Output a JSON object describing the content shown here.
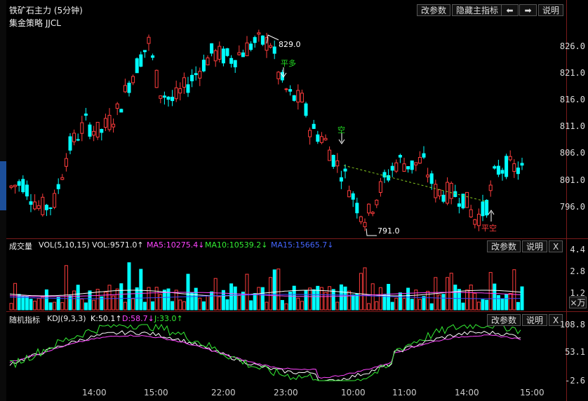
{
  "title": "铁矿石主力 (5分钟)",
  "strategy": "集金策略 JJCL",
  "toolbar": {
    "modify_params": "改参数",
    "hide_main": "隐藏主指标",
    "prev": "⬅",
    "next": "➡",
    "help": "说明"
  },
  "price_axis": [
    "826.0",
    "821.0",
    "816.0",
    "811.0",
    "806.0",
    "801.0",
    "796.0"
  ],
  "annotations": {
    "high": "829.0",
    "low": "791.0",
    "close_long": "平多",
    "short": "空",
    "close_short": "平空"
  },
  "volume_panel": {
    "label": "成交量",
    "vol_params": "VOL(5,10,15)",
    "vol": "VOL:9571.0↑",
    "ma5": "MA5:10275.4↓",
    "ma10": "MA10:10539.2↓",
    "ma15": "MA15:15665.7↓",
    "axis": [
      "4.4",
      "2.8",
      "1.2"
    ],
    "unit": "×万",
    "modify_params": "改参数",
    "help": "说明",
    "close": "X"
  },
  "kdj_panel": {
    "label": "随机指标",
    "params": "KDJ(9,3,3)",
    "k": "K:50.1↑",
    "d": "D:58.7↓",
    "j": "J:33.0↑",
    "axis": [
      "108.8",
      "53.1",
      "-2.6"
    ],
    "modify_params": "改参数",
    "help": "说明",
    "close": "X"
  },
  "time_axis": [
    "14:00",
    "15:00",
    "22:00",
    "23:00",
    "10:00",
    "11:00",
    "14:00",
    "15:00"
  ],
  "colors": {
    "up": "#ff3c3c",
    "down": "#00ffff",
    "k": "#ffffff",
    "d": "#ff44ff",
    "j": "#33ee33",
    "ma15": "#4444ff"
  },
  "chart_data": {
    "type": "candlestick",
    "ylim": [
      791,
      829
    ],
    "high": 829.0,
    "low": 791.0,
    "kdj_ylim": [
      -2.6,
      108.8
    ],
    "volume_ylim_wan": [
      0,
      4.4
    ],
    "last": {
      "vol": 9571.0,
      "ma5": 10275.4,
      "ma10": 10539.2,
      "ma15": 15665.7,
      "k": 50.1,
      "d": 58.7,
      "j": 33.0
    }
  }
}
